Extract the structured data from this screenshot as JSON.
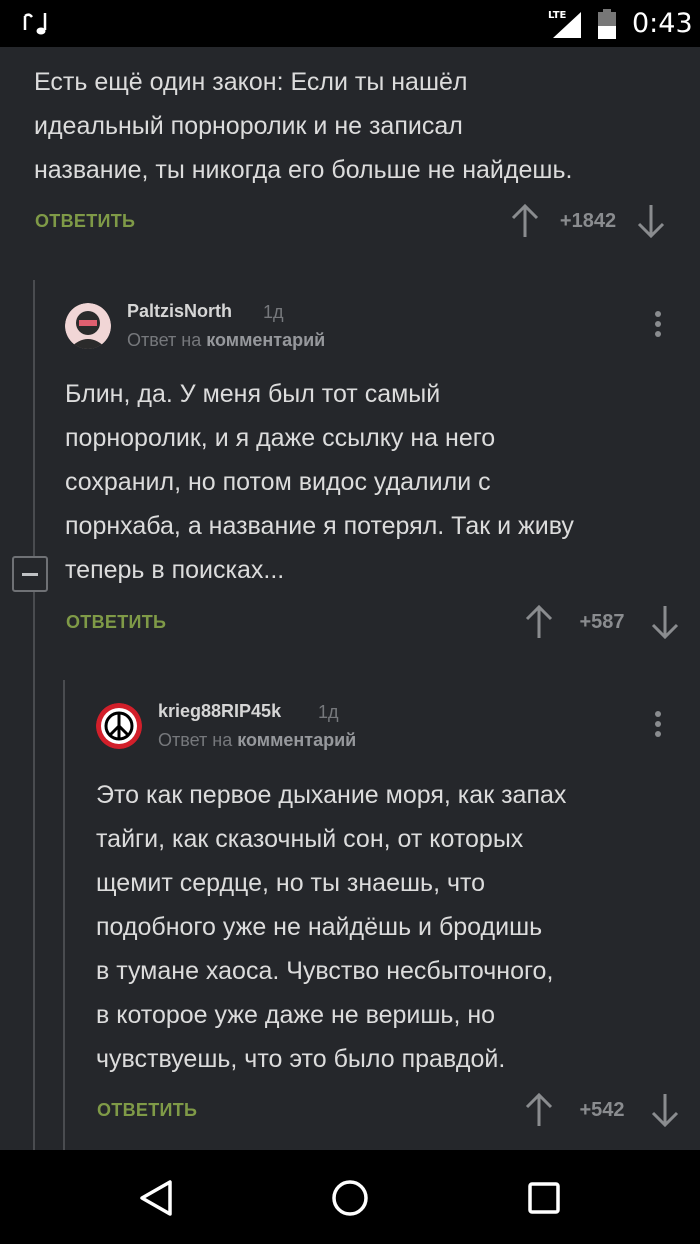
{
  "status_bar": {
    "network": "LTE",
    "time": "0:43",
    "icons": [
      "music-note-icon",
      "signal-icon",
      "battery-icon"
    ]
  },
  "comments": [
    {
      "text": "Есть ещё один закон: Если ты нашёл\nидеальный порноролик и не записал\nназвание, ты никогда его больше не найдешь.",
      "reply_label": "ОТВЕТИТЬ",
      "score": "+1842"
    },
    {
      "username": "PaltzisNorth",
      "time_ago": "1д",
      "reply_to_prefix": "Ответ на",
      "reply_to_link": "комментарий",
      "text": "Блин, да. У меня был тот самый\nпорноролик, и я даже ссылку на него\nсохранил, но потом видос удалили с\nпорнхаба, а название я потерял. Так и живу\nтеперь в поисках...",
      "reply_label": "ОТВЕТИТЬ",
      "score": "+587"
    },
    {
      "username": "krieg88RIP45k",
      "time_ago": "1д",
      "reply_to_prefix": "Ответ на",
      "reply_to_link": "комментарий",
      "text": "Это как первое дыхание моря, как запах\nтайги, как сказочный сон, от которых\nщемит сердце, но ты знаешь, что\nподобного уже не найдёшь и бродишь\nв тумане хаоса. Чувство несбыточного,\nв которое уже даже не веришь, но\nчувствуешь, что это было правдой.",
      "reply_label": "ОТВЕТИТЬ",
      "score": "+542"
    }
  ],
  "colors": {
    "background": "#25272b",
    "reply_green": "#7f9a47",
    "muted": "#8a8c8f"
  },
  "nav_bar": [
    "back-icon",
    "home-icon",
    "recents-icon"
  ]
}
